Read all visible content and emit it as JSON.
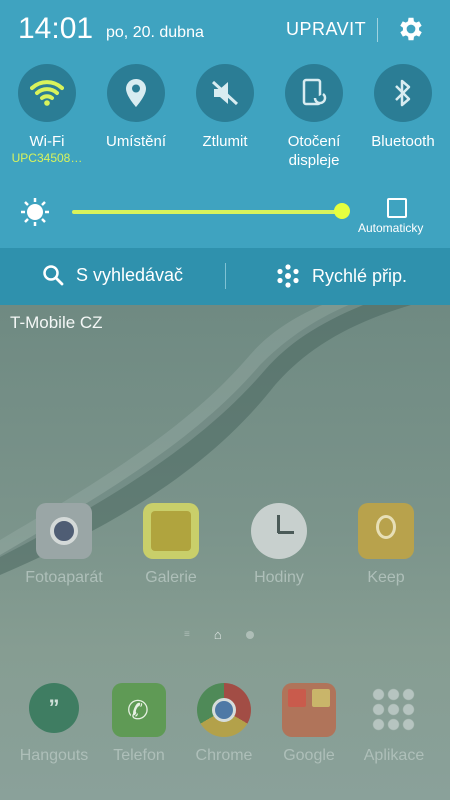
{
  "status": {
    "time": "14:01",
    "date": "po, 20. dubna",
    "edit_label": "UPRAVIT"
  },
  "toggles": [
    {
      "name": "Wi-Fi",
      "sub": "UPC34508…",
      "icon": "wifi-icon"
    },
    {
      "name": "Umístění",
      "icon": "location-icon"
    },
    {
      "name": "Ztlumit",
      "icon": "mute-icon"
    },
    {
      "name": "Otočení",
      "name2": "displeje",
      "icon": "rotation-icon"
    },
    {
      "name": "Bluetooth",
      "icon": "bluetooth-icon"
    }
  ],
  "brightness": {
    "level": 1.0,
    "auto_label": "Automaticky"
  },
  "actions": {
    "search_label": "S vyhledávač",
    "quick_label": "Rychlé přip."
  },
  "home": {
    "carrier": "T-Mobile CZ",
    "apps": [
      "Fotoaparát",
      "Galerie",
      "Hodiny",
      "Keep"
    ],
    "dock": [
      "Hangouts",
      "Telefon",
      "Chrome",
      "Google",
      "Aplikace"
    ]
  },
  "colors": {
    "panel": "#3fa3c0",
    "accent": "#d8f35c",
    "tile": "#2b7d95"
  }
}
